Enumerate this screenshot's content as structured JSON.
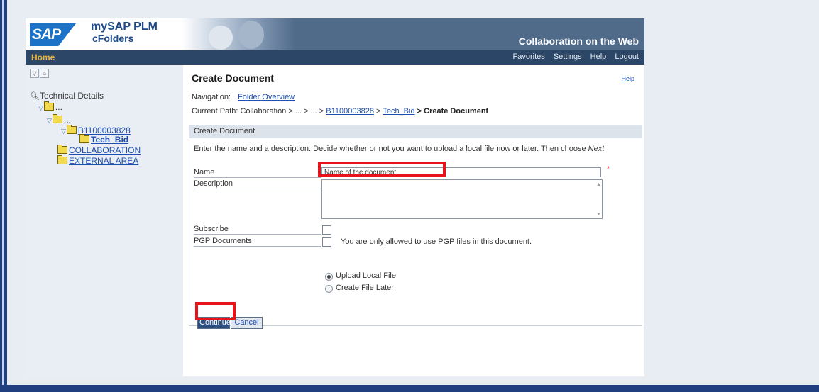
{
  "banner": {
    "logo": "SAP",
    "product_name": "mySAP PLM",
    "product_sub": "cFolders",
    "tagline": "Collaboration on the Web"
  },
  "menubar": {
    "home": "Home",
    "links": [
      "Favorites",
      "Settings",
      "Help",
      "Logout"
    ]
  },
  "sidebar": {
    "tool_icons": [
      "collapse-icon",
      "home-icon"
    ],
    "root": "Technical Details",
    "level1": "...",
    "level2": "...",
    "folder": "B1100003828",
    "current": "Tech_Bid",
    "collab": "COLLABORATION",
    "external": "EXTERNAL AREA"
  },
  "page": {
    "title": "Create Document",
    "help": "Help",
    "nav_label": "Navigation:",
    "nav_link": "Folder Overview",
    "path_label": "Current Path:",
    "path_prefix": "Collaboration > ... > ... >",
    "path_folder": "B1100003828",
    "path_sep": ">",
    "path_current": "Tech_Bid",
    "path_end": "> Create Document"
  },
  "form": {
    "header": "Create Document",
    "instructions_text": "Enter the name and a description. Decide whether or not you want to upload a local file now or later. Then choose",
    "instructions_next": "Next",
    "name_label": "Name",
    "name_placeholder": "Name of the document",
    "required_mark": "*",
    "description_label": "Description",
    "subscribe_label": "Subscribe",
    "pgp_label": "PGP Documents",
    "pgp_note": "You are only allowed to use PGP files in this document.",
    "radio_upload": "Upload Local File",
    "radio_later": "Create File Later",
    "upload_selected": true,
    "continue": "Continue",
    "cancel": "Cancel"
  },
  "highlight_color": "#e8141c"
}
